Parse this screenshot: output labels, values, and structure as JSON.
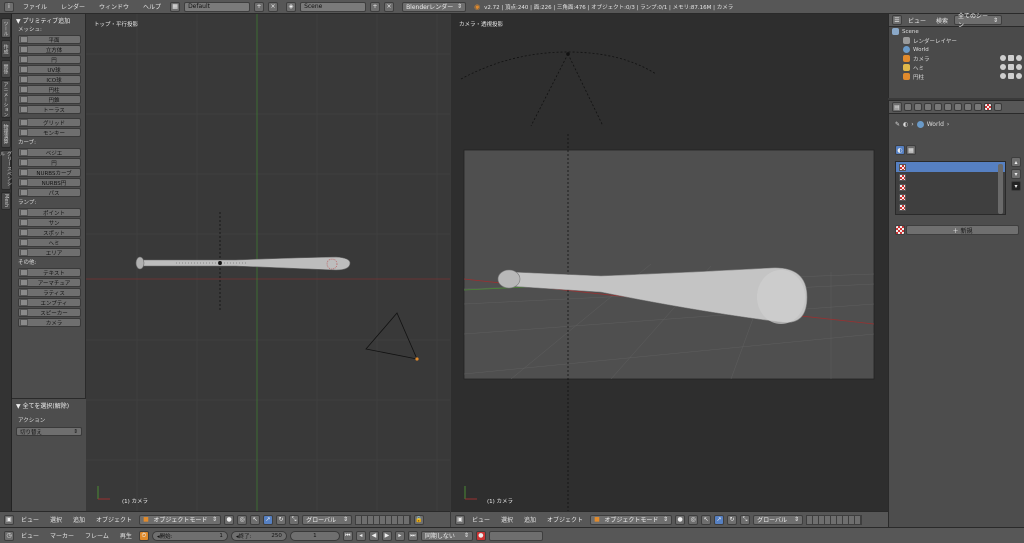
{
  "topbar": {
    "menus": [
      "ファイル",
      "レンダー",
      "ウィンドウ",
      "ヘルプ"
    ],
    "screen_layout": "Default",
    "scene": "Scene",
    "render_engine": "Blenderレンダー",
    "stats": "v2.72 | 頂点:240 | 面:226 | 三角面:476 | オブジェクト:0/3 | ランプ:0/1 | メモリ:87.16M | カメラ"
  },
  "lefttabs": [
    "ツール",
    "作成",
    "関係",
    "アニメーション",
    "物理演算",
    "グリースペンシル",
    "Mesh"
  ],
  "toolshelf": {
    "header": "▼ プリミティブ追加",
    "mesh_label": "メッシュ:",
    "mesh": [
      "平面",
      "立方体",
      "円",
      "UV球",
      "ICO球",
      "円柱",
      "円錐",
      "トーラス"
    ],
    "mesh2": [
      "グリッド",
      "モンキー"
    ],
    "curve_label": "カーブ:",
    "curve": [
      "ベジエ",
      "円",
      "NURBSカーブ",
      "NURBS円",
      "パス"
    ],
    "lamp_label": "ランプ:",
    "lamp": [
      "ポイント",
      "サン",
      "スポット",
      "ヘミ",
      "エリア"
    ],
    "other_label": "その他:",
    "other": [
      "テキスト",
      "アーマチュア",
      "ラティス",
      "エンプティ",
      "スピーカー",
      "カメラ"
    ]
  },
  "operator": {
    "header": "▼ 全てを選択(解除)",
    "action_label": "アクション",
    "action_value": "切り替え"
  },
  "viewport_left": {
    "label": "トップ・平行投影",
    "object_name": "(1) カメラ"
  },
  "viewport_right": {
    "label": "カメラ・透視投影",
    "object_name": "(1) カメラ"
  },
  "view_header": {
    "menus": [
      "ビュー",
      "選択",
      "追加",
      "オブジェクト"
    ],
    "mode": "オブジェクトモード",
    "orientation": "グローバル"
  },
  "timeline": {
    "menus": [
      "ビュー",
      "マーカー",
      "フレーム",
      "再生"
    ],
    "start_label": "◂開始:",
    "start_value": "1",
    "end_label": "◂終了:",
    "end_value": "250",
    "current_frame": "1",
    "sync": "同期しない"
  },
  "outliner": {
    "menus": [
      "ビュー",
      "検索"
    ],
    "filter": "全てのシーン",
    "items": [
      {
        "label": "Scene",
        "indent": 0
      },
      {
        "label": "レンダーレイヤー",
        "indent": 1
      },
      {
        "label": "World",
        "indent": 1
      },
      {
        "label": "カメラ",
        "indent": 1
      },
      {
        "label": "ヘミ",
        "indent": 1
      },
      {
        "label": "円柱",
        "indent": 1
      }
    ]
  },
  "properties": {
    "breadcrumb": "World",
    "new_button": "新規"
  },
  "colors": {
    "x_axis": "#9a3030",
    "y_axis": "#4a8a34",
    "selected_slot": "#5680c2",
    "camera_frame_bg": "#4f4f4f"
  }
}
